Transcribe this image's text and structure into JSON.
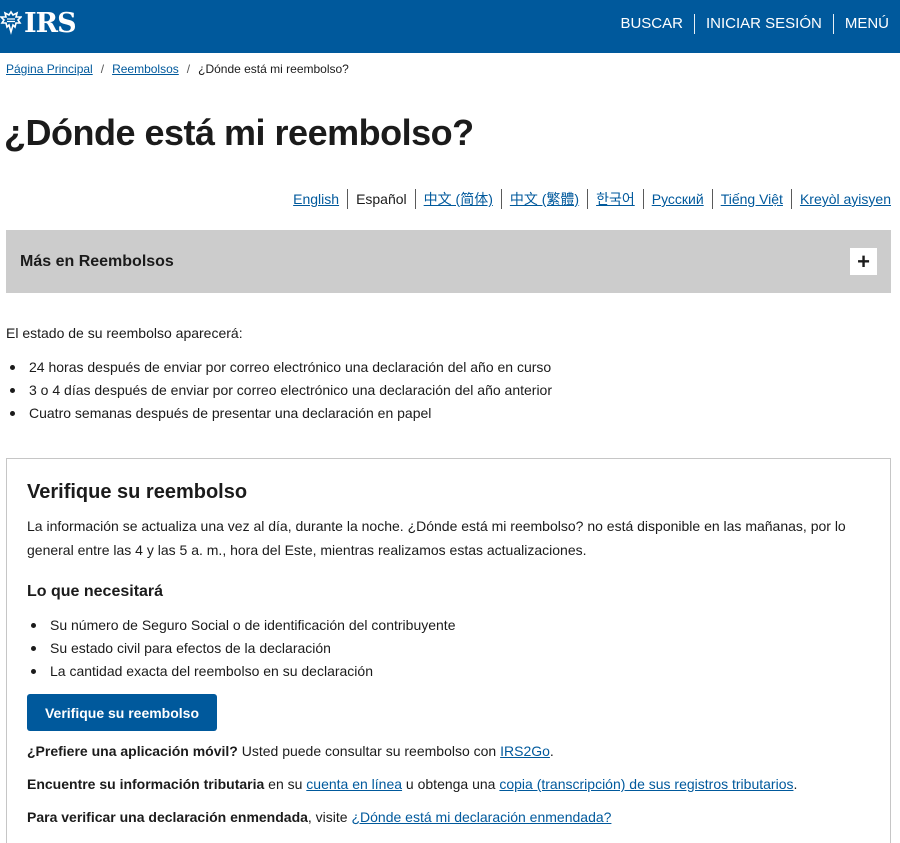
{
  "header": {
    "logo_text": "IRS",
    "logo_icon": "eagle-icon",
    "nav": [
      "BUSCAR",
      "INICIAR SESIÓN",
      "MENÚ"
    ],
    "background": "#00599c"
  },
  "breadcrumb": {
    "home": "Página Principal",
    "refunds": "Reembolsos",
    "current": "¿Dónde está mi reembolso?"
  },
  "page_title": "¿Dónde está mi reembolso?",
  "languages": {
    "english": "English",
    "espanol": "Español",
    "zh_hans": "中文 (简体)",
    "zh_hant": "中文 (繁體)",
    "korean": "한국어",
    "russian": "Русский",
    "vietnamese": "Tiếng Việt",
    "creole": "Kreyòl ayisyen"
  },
  "accordion": {
    "title": "Más en Reembolsos",
    "toggle": "+"
  },
  "intro": {
    "text": "El estado de su reembolso aparecerá:",
    "items": [
      "24 horas después de enviar por correo electrónico una declaración del año en curso",
      "3 o 4 días después de enviar por correo electrónico una declaración del año anterior",
      "Cuatro semanas después de presentar una declaración en papel"
    ]
  },
  "card": {
    "title": "Verifique su reembolso",
    "description": "La información se actualiza una vez al día, durante la noche. ¿Dónde está mi reembolso? no está disponible en las mañanas, por lo general entre las 4 y las 5 a. m., hora del Este, mientras realizamos estas actualizaciones.",
    "need_title": "Lo que necesitará",
    "need_items": [
      "Su número de Seguro Social o de identificación del contribuyente",
      "Su estado civil para efectos de la declaración",
      "La cantidad exacta del reembolso en su declaración"
    ],
    "button_label": "Verifique su reembolso",
    "app_bold": "¿Prefiere una aplicación móvil?",
    "app_text": " Usted puede consultar su reembolso con ",
    "app_link": "IRS2Go",
    "app_end": ".",
    "tax_bold": "Encuentre su información tributaria",
    "tax_text1": " en su ",
    "tax_link1": "cuenta en línea",
    "tax_text2": " u obtenga una ",
    "tax_link2": "copia (transcripción) de sus registros tributarios",
    "tax_end": ".",
    "amend_bold": "Para verificar una declaración enmendada",
    "amend_text": ", visite ",
    "amend_link": "¿Dónde está mi declaración enmendada?"
  }
}
